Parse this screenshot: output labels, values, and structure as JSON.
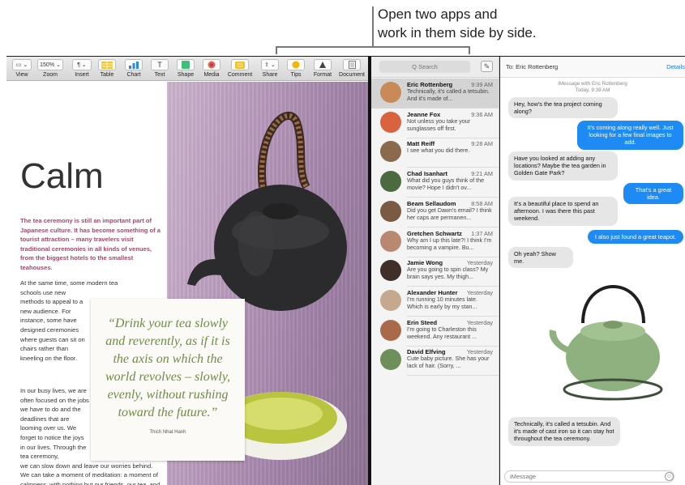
{
  "callout": {
    "line1": "Open two apps and",
    "line2": "work in them side by side."
  },
  "pages": {
    "toolbar": [
      {
        "name": "view",
        "label": "View",
        "control": "▭ ⌄"
      },
      {
        "name": "zoom",
        "label": "Zoom",
        "control": "150% ⌄"
      },
      {
        "name": "insert",
        "label": "Insert",
        "control": "¶ ⌄"
      },
      {
        "name": "table",
        "label": "Table",
        "control": ""
      },
      {
        "name": "chart",
        "label": "Chart",
        "control": ""
      },
      {
        "name": "text",
        "label": "Text",
        "control": "T"
      },
      {
        "name": "shape",
        "label": "Shape",
        "control": ""
      },
      {
        "name": "media",
        "label": "Media",
        "control": ""
      },
      {
        "name": "comment",
        "label": "Comment",
        "control": ""
      },
      {
        "name": "share",
        "label": "Share",
        "control": "⇧ ⌄"
      },
      {
        "name": "tips",
        "label": "Tips",
        "control": ""
      },
      {
        "name": "format",
        "label": "Format",
        "control": ""
      },
      {
        "name": "document",
        "label": "Document",
        "control": ""
      }
    ],
    "doc": {
      "title": "Calm",
      "lede": "The tea ceremony is still an important part of Japanese culture. It has become something of a tourist attraction – many travelers visit traditional ceremonies in all kinds of venues, from the biggest hotels to the smallest teahouses.",
      "body1_wide": "At the same time, some modern tea",
      "body1_narrow": "schools use new methods to appeal to a new audience. For instance, some have designed ceremonies where guests can sit on chairs rather than kneeling on the floor.",
      "body2_narrow": "In our busy lives, we are often focused on the jobs we have to do and the deadlines that are looming over us. We forget to notice the joys in our lives. Through the tea ceremony,",
      "body2_wide": "we can slow down and leave our worries behind. We can take a moment of meditation: a moment of calmness, with nothing but our friends, our tea, and the",
      "quote": "“Drink your tea slowly and reverently, as if it is the axis on which the world revolves – slowly, evenly, without rushing toward the future.”",
      "quote_author": "Thich Nhat Hanh"
    }
  },
  "messages": {
    "search_placeholder": "Q Search",
    "compose_icon": "✎",
    "conversations": [
      {
        "name": "Eric Rottenberg",
        "time": "9:39 AM",
        "preview": "Technically, it's called a tetsubin. And it's made of...",
        "avatar_color": "#c98a5a",
        "selected": true
      },
      {
        "name": "Jeanne Fox",
        "time": "9:36 AM",
        "preview": "Not unless you take your sunglasses off first.",
        "avatar_color": "#d9623f",
        "selected": false
      },
      {
        "name": "Matt Reiff",
        "time": "9:28 AM",
        "preview": "I see what you did there.",
        "avatar_color": "#8a6a4c",
        "selected": false
      },
      {
        "name": "Chad Isanhart",
        "time": "9:21 AM",
        "preview": "What did you guys think of the movie? Hope I didn't ov...",
        "avatar_color": "#4c6a3f",
        "selected": false
      },
      {
        "name": "Beam Sellaudom",
        "time": "8:58 AM",
        "preview": "Did you get Dawn's email? I think her caps are permanen...",
        "avatar_color": "#7b5a44",
        "selected": false
      },
      {
        "name": "Gretchen Schwartz",
        "time": "1:37 AM",
        "preview": "Why am I up this late?! I think I'm becoming a vampire. Bu...",
        "avatar_color": "#b98870",
        "selected": false
      },
      {
        "name": "Jamie Wong",
        "time": "Yesterday",
        "preview": "Are you going to spin class? My brain says yes. My thigh...",
        "avatar_color": "#3f2f28",
        "selected": false
      },
      {
        "name": "Alexander Hunter",
        "time": "Yesterday",
        "preview": "I'm running 10 minutes late. Which is early by my stan...",
        "avatar_color": "#c6a88e",
        "selected": false
      },
      {
        "name": "Erin Steed",
        "time": "Yesterday",
        "preview": "I'm going to Charleston this weekend. Any restaurant ...",
        "avatar_color": "#a86a4a",
        "selected": false
      },
      {
        "name": "David Elfving",
        "time": "Yesterday",
        "preview": "Cute baby picture. She has your lack of hair. (Sorry, ...",
        "avatar_color": "#6e8e5a",
        "selected": false
      }
    ],
    "chat": {
      "to": "To:  Eric Rottenberg",
      "details": "Details",
      "meta_line1": "iMessage with  Eric Rottenberg",
      "meta_line2": "Today, 9:39 AM",
      "bubbles": [
        {
          "dir": "in",
          "text": "Hey, how's the tea project coming along?"
        },
        {
          "dir": "out",
          "text": "It's coming along really well. Just looking for a few final images to add."
        },
        {
          "dir": "in",
          "text": "Have you looked at adding any locations? Maybe the tea garden in Golden Gate Park?"
        },
        {
          "dir": "out",
          "text": "That's a great idea."
        },
        {
          "dir": "in",
          "text": "It's a beautiful place to spend an afternoon. I was there this past weekend."
        },
        {
          "dir": "out",
          "text": "I also just found a great teapot."
        },
        {
          "dir": "in",
          "text": "Oh yeah? Show me."
        },
        {
          "dir": "in",
          "text": "Technically, it's called a tetsubin. And it's made of cast iron so it can stay hot throughout the tea ceremony."
        }
      ],
      "input_placeholder": "iMessage",
      "emoji_icon": "☺"
    }
  },
  "colors": {
    "accent_blue": "#1e8bf5",
    "lede_magenta": "#a4476c",
    "quote_green": "#6e8c44",
    "photo_purple": "#b99bbd"
  }
}
